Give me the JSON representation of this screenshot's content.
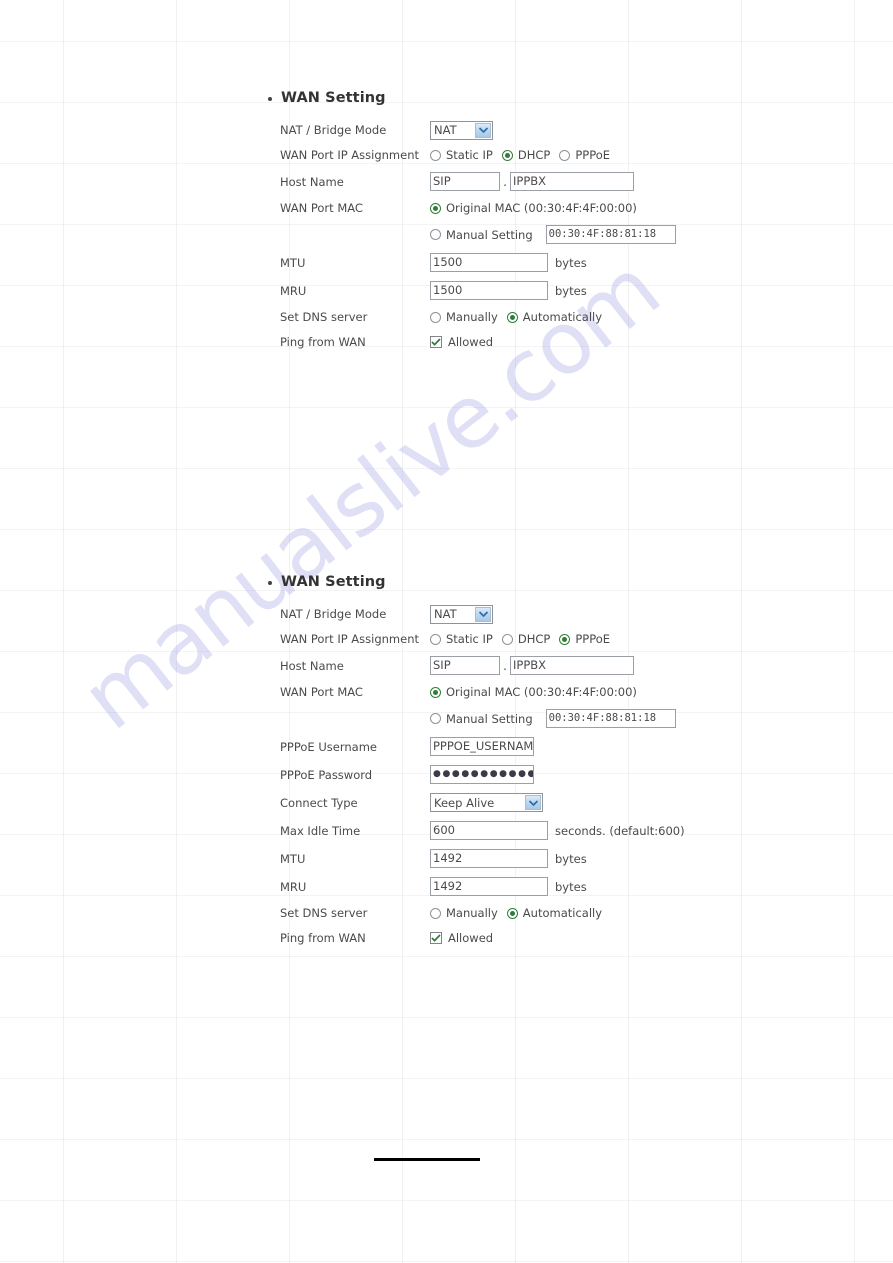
{
  "watermark": {
    "text": "manualslive.com"
  },
  "panels": [
    {
      "title": "WAN Setting",
      "rows": {
        "nat_bridge_label": "NAT / Bridge Mode",
        "nat_bridge_value": "NAT",
        "ip_assignment_label": "WAN Port IP Assignment",
        "ip_assignment_options": [
          "Static IP",
          "DHCP",
          "PPPoE"
        ],
        "ip_assignment_selected": "DHCP",
        "host_name_label": "Host Name",
        "host_name_part1": "SIP",
        "host_name_separator": ".",
        "host_name_part2": "IPPBX",
        "wan_port_mac_label": "WAN Port MAC",
        "original_mac_label": "Original MAC (00:30:4F:4F:00:00)",
        "manual_setting_label": "Manual Setting",
        "manual_mac_value": "00:30:4F:88:81:18",
        "mac_selected": "Original MAC",
        "mtu_label": "MTU",
        "mtu_value": "1500",
        "mtu_unit": "bytes",
        "mru_label": "MRU",
        "mru_value": "1500",
        "mru_unit": "bytes",
        "dns_label": "Set DNS server",
        "dns_options": [
          "Manually",
          "Automatically"
        ],
        "dns_selected": "Automatically",
        "ping_label": "Ping from WAN",
        "ping_checkbox_label": "Allowed",
        "ping_checked": true
      }
    },
    {
      "title": "WAN Setting",
      "rows": {
        "nat_bridge_label": "NAT / Bridge Mode",
        "nat_bridge_value": "NAT",
        "ip_assignment_label": "WAN Port IP Assignment",
        "ip_assignment_options": [
          "Static IP",
          "DHCP",
          "PPPoE"
        ],
        "ip_assignment_selected": "PPPoE",
        "host_name_label": "Host Name",
        "host_name_part1": "SIP",
        "host_name_separator": ".",
        "host_name_part2": "IPPBX",
        "wan_port_mac_label": "WAN Port MAC",
        "original_mac_label": "Original MAC (00:30:4F:4F:00:00)",
        "manual_setting_label": "Manual Setting",
        "manual_mac_value": "00:30:4F:88:81:18",
        "mac_selected": "Original MAC",
        "pppoe_username_label": "PPPoE Username",
        "pppoe_username_value": "PPPOE_USERNAME",
        "pppoe_password_label": "PPPoE Password",
        "pppoe_password_masked": "●●●●●●●●●●●●●",
        "connect_type_label": "Connect Type",
        "connect_type_value": "Keep Alive",
        "max_idle_label": "Max Idle Time",
        "max_idle_value": "600",
        "max_idle_unit": "seconds. (default:600)",
        "mtu_label": "MTU",
        "mtu_value": "1492",
        "mtu_unit": "bytes",
        "mru_label": "MRU",
        "mru_value": "1492",
        "mru_unit": "bytes",
        "dns_label": "Set DNS server",
        "dns_options": [
          "Manually",
          "Automatically"
        ],
        "dns_selected": "Automatically",
        "ping_label": "Ping from WAN",
        "ping_checkbox_label": "Allowed",
        "ping_checked": true
      }
    }
  ],
  "colors": {
    "radio_on": "#2f7d3a",
    "check_mark": "#2f7d3a",
    "select_button": "#bcd6ef",
    "watermark": "#9696e1"
  }
}
